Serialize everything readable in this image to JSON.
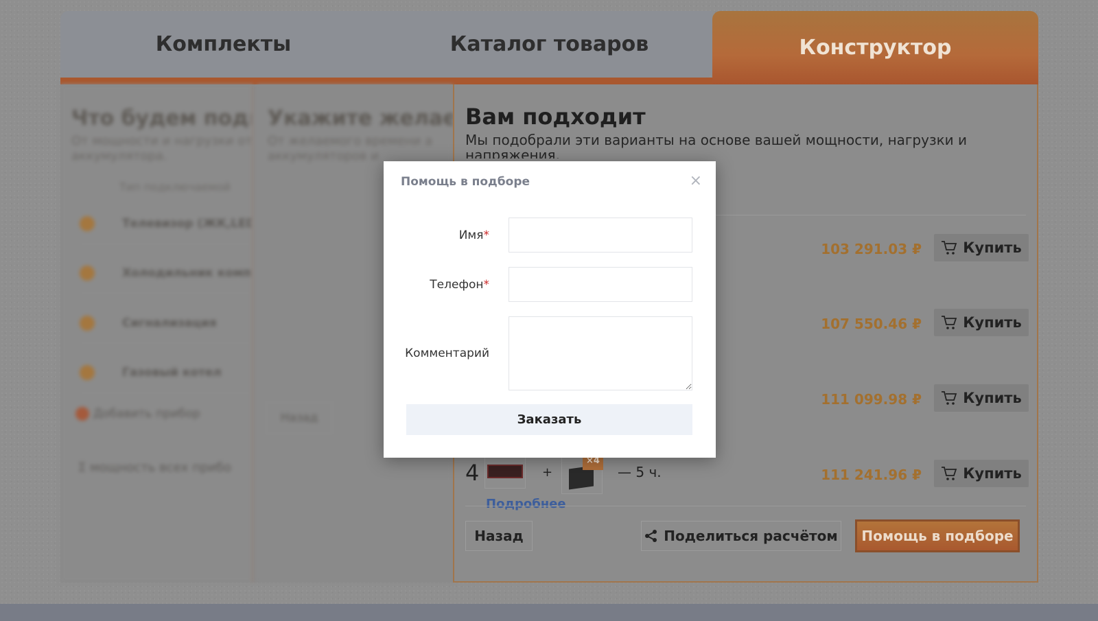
{
  "tabs": [
    {
      "label": "Комплекты"
    },
    {
      "label": "Каталог товаров"
    },
    {
      "label": "Конструктор"
    }
  ],
  "left_panel": {
    "title": "Что будем подк",
    "subtitle": "От мощности и нагрузки от аккумулятора.",
    "type_label": "Тип подключаемой",
    "items": [
      {
        "label": "Телевизор (ЖК,LED)"
      },
      {
        "label": "Холодильник компр"
      },
      {
        "label": "Сигнализация"
      },
      {
        "label": "Газовый котел"
      }
    ],
    "add_label": "Добавить прибор",
    "total_label": "Σ мощность всех прибо"
  },
  "middle_panel": {
    "title": "Укажите желае",
    "subtitle": "От желаемого времени а аккумуляторов и",
    "back_label": "Назад"
  },
  "result": {
    "title": "Вам подходит",
    "subtitle": "Мы подобрали эти варианты на основе вашей мощности, нагрузки и напряжения.",
    "rows": [
      {
        "price": "103 291.03 ₽",
        "buy_label": "Купить"
      },
      {
        "price": "107 550.46 ₽",
        "buy_label": "Купить"
      },
      {
        "price": "111 099.98 ₽",
        "buy_label": "Купить"
      },
      {
        "price": "111 241.96 ₽",
        "buy_label": "Купить"
      }
    ],
    "row4": {
      "num": "4",
      "plus": "+",
      "badge": "×4",
      "hours": "— 5 ч.",
      "more": "Подробнее"
    },
    "back_label": "Назад",
    "share_label": "Поделиться расчётом",
    "help_label": "Помощь в подборе"
  },
  "modal": {
    "title": "Помощь в подборе",
    "close": "×",
    "name_label": "Имя",
    "phone_label": "Телефон",
    "comment_label": "Комментарий",
    "required_mark": "*",
    "name_value": "",
    "phone_value": "",
    "comment_value": "",
    "submit_label": "Заказать"
  },
  "colors": {
    "accent": "#e8913a",
    "price": "#e8913a",
    "link": "#2e6fd1",
    "required": "#cc2a2a"
  }
}
